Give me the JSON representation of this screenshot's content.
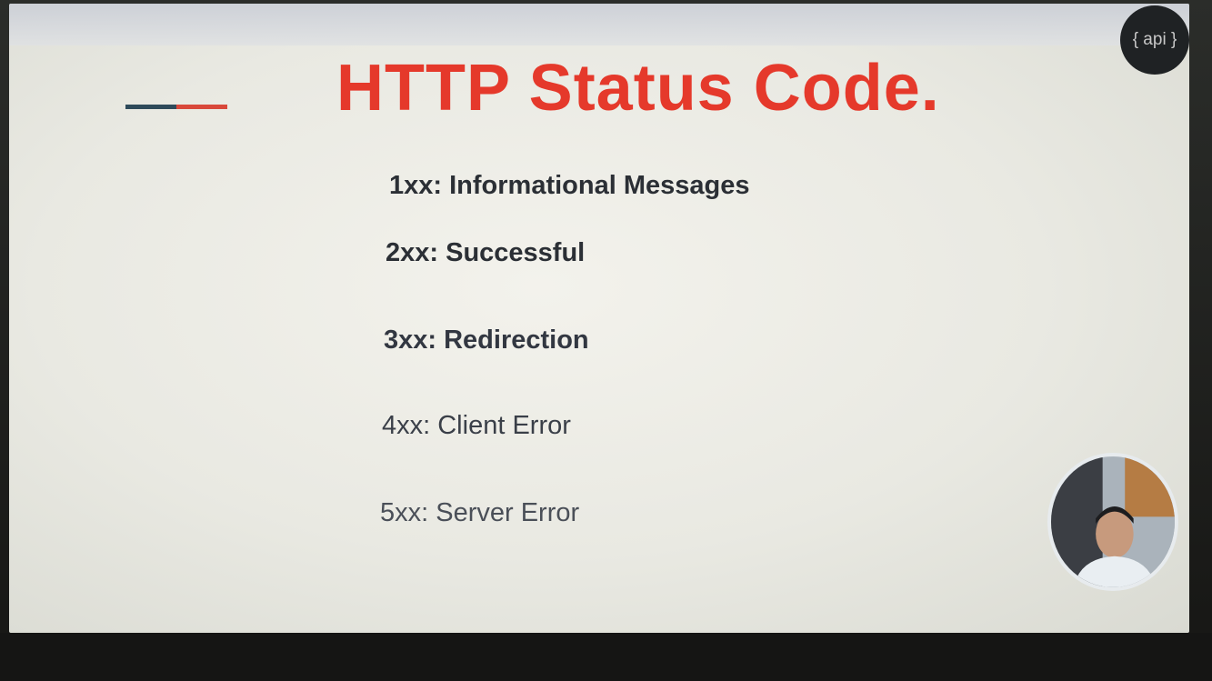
{
  "slide": {
    "title": "HTTP Status Code.",
    "items": [
      "1xx: Informational Messages",
      "2xx: Successful",
      "3xx: Redirection",
      "4xx: Client Error",
      "5xx: Server Error"
    ]
  },
  "badge": {
    "label": "{ api }"
  },
  "colors": {
    "title": "#e5392b",
    "accent_dark": "#2e4a5a",
    "accent_red": "#d9483a",
    "text": "#2b2f35"
  },
  "icons": {
    "webcam": "person-icon"
  }
}
